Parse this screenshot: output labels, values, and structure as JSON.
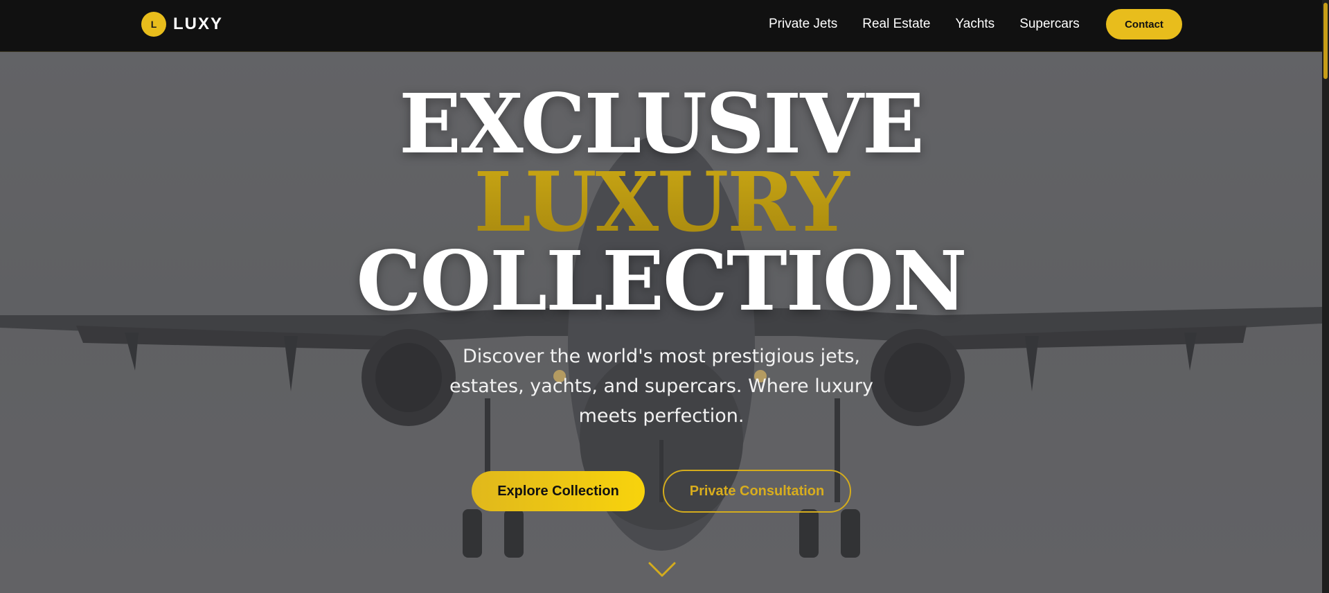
{
  "brand": {
    "logo_letter": "L",
    "name": "LUXY"
  },
  "nav": {
    "links": [
      "Private Jets",
      "Real Estate",
      "Yachts",
      "Supercars"
    ],
    "contact_label": "Contact"
  },
  "hero": {
    "line1": "EXCLUSIVE",
    "line2": "LUXURY",
    "line3": "COLLECTION",
    "subtitle": "Discover the world's most prestigious jets, estates, yachts, and supercars. Where luxury meets perfection.",
    "primary_cta": "Explore Collection",
    "secondary_cta": "Private Consultation"
  },
  "colors": {
    "accent": "#e8bd1c",
    "nav_bg": "#111111",
    "hero_overlay": "#5e5f62"
  },
  "icons": [
    "chevron-down-icon"
  ]
}
